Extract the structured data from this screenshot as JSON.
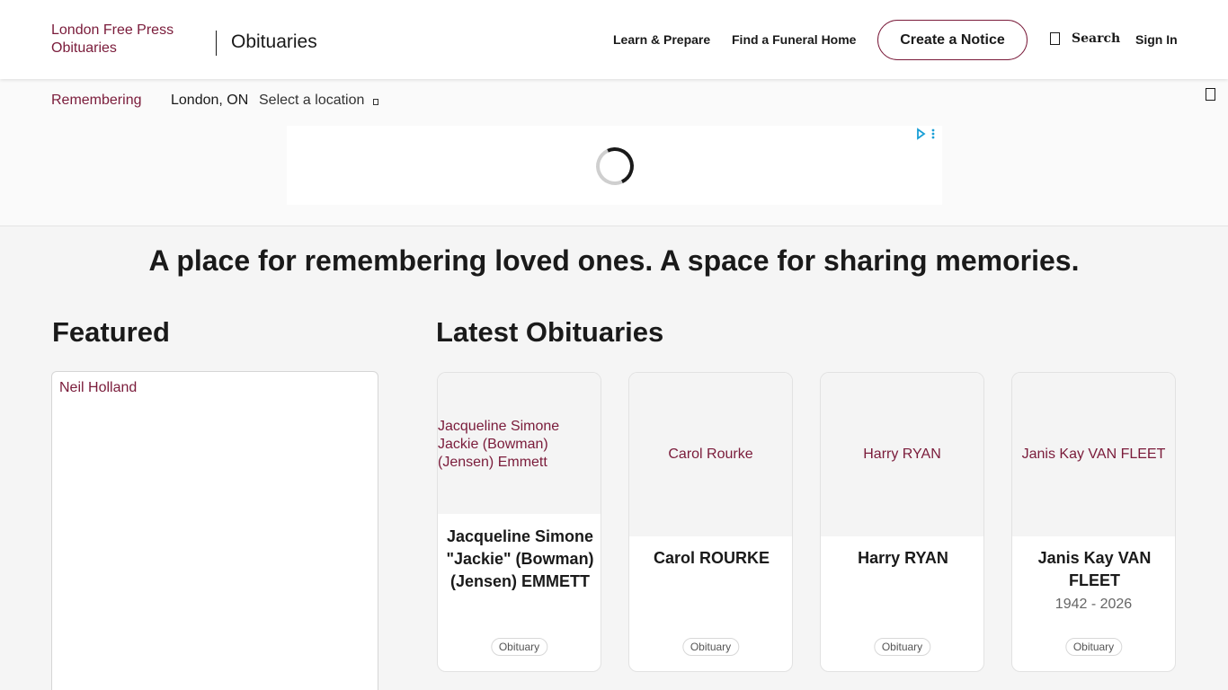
{
  "header": {
    "logo_alt": "London Free Press Obituaries",
    "brand_title": "Obituaries",
    "nav": {
      "learn": "Learn & Prepare",
      "funeral": "Find a Funeral Home",
      "create": "Create a Notice",
      "search": "Search",
      "signin": "Sign In"
    }
  },
  "location_bar": {
    "remembering_alt": "Remembering",
    "city": "London, ON",
    "select_label": "Select a location"
  },
  "main": {
    "tagline": "A place for remembering loved ones. A space for sharing memories.",
    "featured_heading": "Featured",
    "featured_alt": "Neil Holland",
    "latest_heading": "Latest Obituaries",
    "obituaries": [
      {
        "image_alt": "Jacqueline Simone Jackie (Bowman) (Jensen) Emmett",
        "name": "Jacqueline Simone \"Jackie\" (Bowman) (Jensen) EMMETT",
        "years": "",
        "tag": "Obituary"
      },
      {
        "image_alt": "Carol Rourke",
        "name": "Carol ROURKE",
        "years": "",
        "tag": "Obituary"
      },
      {
        "image_alt": "Harry RYAN",
        "name": "Harry RYAN",
        "years": "",
        "tag": "Obituary"
      },
      {
        "image_alt": "Janis Kay VAN FLEET",
        "name": "Janis Kay VAN FLEET",
        "years": "1942 - 2026",
        "tag": "Obituary"
      }
    ]
  },
  "colors": {
    "accent": "#7a1b3a",
    "text": "#1a1a1a",
    "background": "#f5f5f5"
  },
  "icons": {
    "search": "search-icon",
    "location_dropdown": "chevron-down-icon",
    "ad_choices": "ad-choices-icon",
    "loading": "spinner-icon"
  }
}
